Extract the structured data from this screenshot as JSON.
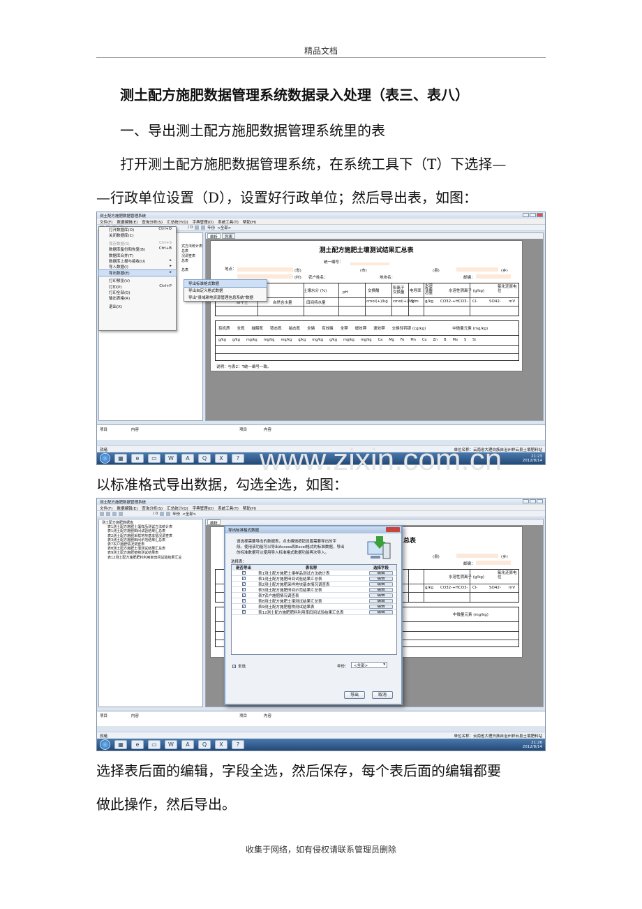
{
  "header": {
    "text": "精品文档"
  },
  "footer": {
    "text": "收集于网络，如有侵权请联系管理员删除"
  },
  "watermark": {
    "text": "www.zixin.com.cn"
  },
  "doc": {
    "title": "测土配方施肥数据管理系统数据录入处理（表三、表八）",
    "step1": "一、导出测土配方施肥数据管理系统里的表",
    "para1a": "打开测土配方施肥数据管理系统，在系统工具下（T）下选择—",
    "para1b": "—行政单位设置（D），设置好行政单位；然后导出表，如图：",
    "para2": "以标准格式导出数据，勾选全选，如图：",
    "para3a": "选择表后面的编辑，字段全选，然后保存，每个表后面的编辑都要",
    "para3b": "做此操作，然后导出。"
  },
  "app": {
    "window_title": "测土配方施肥数据管理系统",
    "menus": [
      "文件(F)",
      "数据编辑(E)",
      "查询分析(S)",
      "汇总统计(Q)",
      "字典管理(D)",
      "系统工具(T)",
      "帮助(H)"
    ],
    "toolbar_year": "年份",
    "toolbar_all": "<全部>",
    "toolbar_page": "/ 0",
    "tabs": [
      "维析",
      "列表"
    ],
    "sheet_title": "测土配方施肥土壤测试结果汇总表",
    "sheet_fields": {
      "unified_no": "统一编号：",
      "location": "地点：",
      "sheng": "(省)",
      "shi": "(市)",
      "xian": "(县)",
      "xiang": "(乡)",
      "cun": "(村)",
      "farmer": "农户姓名：",
      "plot": "地块名：",
      "postcode": "邮编："
    },
    "sheet_headers": [
      "土壤水分 (%)",
      "pH",
      "交换酸",
      "阳离子交换量",
      "电导率",
      "水溶性盐总量",
      "水溶性阴离子 (g/kg)",
      "氧化还原电位"
    ],
    "sheet_units": [
      "烘干土",
      "自然含水量",
      "田间持水量",
      "cmol(+)/kg",
      "cmol(+)/kg",
      "S/m",
      "g/kg",
      "CO32-+HCO3-",
      "Cl-",
      "SO42-",
      "mV"
    ],
    "sheet_headers2": [
      "有机质",
      "全氮",
      "碱解氮",
      "铵态氮",
      "硝态氮",
      "全磷",
      "有效磷",
      "全钾",
      "缓效钾",
      "速效钾",
      "交换性钙镁 (cg/kg)",
      "中微量元素 (mg/kg)"
    ],
    "sheet_units2": [
      "g/kg",
      "g/kg",
      "mg/kg",
      "mg/kg",
      "mg/kg",
      "g/kg",
      "mg/kg",
      "g/kg",
      "mg/kg",
      "mg/kg",
      "Ca",
      "Mg",
      "Fe",
      "Mn",
      "Cu",
      "Zn",
      "B",
      "Mo",
      "S",
      "Si"
    ],
    "sheet_note": "说明：与表2：T统一编号一致。",
    "bottom_cols": [
      "项目",
      "内容",
      "项目",
      "内容"
    ],
    "status_left": "就绪",
    "status_right": "单位名称：云南省大理白族自治州祥云县土壤肥料站",
    "clock1": {
      "time": "21:23",
      "date": "2012/8/14"
    },
    "clock2": {
      "time": "21:26",
      "date": "2012/8/14"
    },
    "file_menu": [
      {
        "label": "打开数据库(O)",
        "key": "Ctrl+O",
        "state": "normal"
      },
      {
        "label": "关闭数据库(C)",
        "key": "",
        "state": "normal"
      },
      {
        "label": "保存数据(S)",
        "key": "Ctrl+S",
        "state": "disabled"
      },
      {
        "label": "数据库备份和恢复(B)",
        "key": "Ctrl+B",
        "state": "normal"
      },
      {
        "label": "数据库合并(T)",
        "key": "",
        "state": "normal"
      },
      {
        "label": "数据库上报与接收(U)",
        "key": "▸",
        "state": "normal"
      },
      {
        "label": "导入数据(I)",
        "key": "▸",
        "state": "normal"
      },
      {
        "label": "导出数据(E)",
        "key": "▸",
        "state": "selected"
      },
      {
        "label": "打印预览(V)",
        "key": "",
        "state": "normal"
      },
      {
        "label": "打印(P)",
        "key": "Ctrl+P",
        "state": "normal"
      },
      {
        "label": "打印全部(Q)",
        "key": "",
        "state": "normal"
      },
      {
        "label": "输出表格(R)",
        "key": "",
        "state": "normal"
      },
      {
        "label": "退出(X)",
        "key": "",
        "state": "normal"
      }
    ],
    "export_submenu": [
      "导出标准格式数据",
      "导出自定义格式数据",
      "导出\"县域耕地资源管理信息系统\"数据"
    ],
    "tree_root": "测土配方施肥数据库",
    "tree_items": [
      "表1测土配方施肥土壤样品测试方法统计表",
      "表1测土配方施肥田间试验结果汇总表",
      "表2测土配方施肥采样地块基本情况调查表",
      "表3测土配方施肥田间示范结果汇总表",
      "表7农户施肥情况调查表",
      "表8测土配方施肥土壤测试结果汇总表",
      "表9测土配方施肥植物测试结果表",
      "表12测土配方施肥肥料利用率田间试验结果汇总"
    ],
    "side_labels": [
      "式方法统计表",
      "总表",
      "况调查表",
      "总表",
      "总表"
    ]
  },
  "dialog": {
    "title": "导出标准格式数据",
    "desc1": "请选择需要导出的数据表，点击编辑按钮设置需要导出的字",
    "desc2": "段。使用该功能可以导出Access和Excel格式的标准数据，导出",
    "desc3": "的标准数据可以使用导入标准格式数据功能再次导入。",
    "select_label": "选择表：",
    "col_export": "是否导出",
    "col_name": "表名称",
    "col_field": "选择字段",
    "rows": [
      "表1测土配方施肥土壤样品测试方法统计表",
      "表1测土配方施肥田间试验结果汇总表",
      "表2测土配方施肥采样地块基本情况调查表",
      "表3测土配方施肥田间示范结果汇总表",
      "表7农户施肥情况调查表",
      "表8测土配方施肥土壤测试结果汇总表",
      "表9测土配方施肥植物测试结果表",
      "表12测土配方施肥肥料利用率田间试验结果汇总表"
    ],
    "edit_label": "编辑",
    "select_all": "全选",
    "year_label": "年份：",
    "year_value": "<全部>",
    "export_btn": "导出",
    "cancel_btn": "取消"
  }
}
